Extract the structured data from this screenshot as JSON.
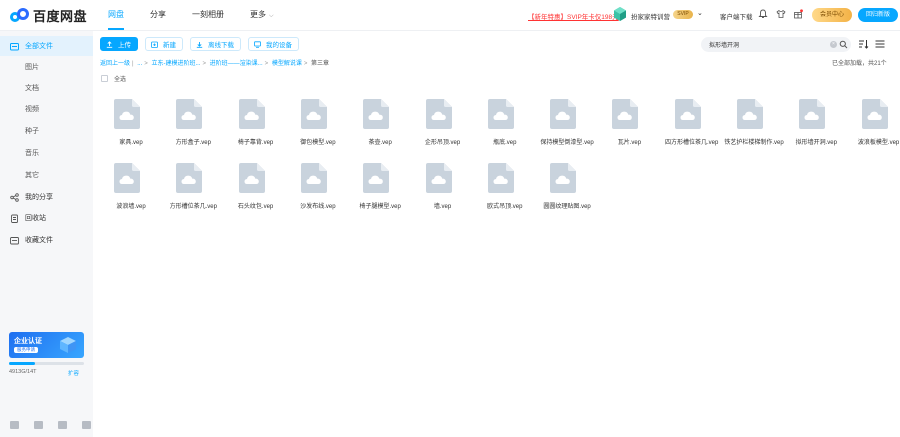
{
  "header": {
    "logo_text": "百度网盘",
    "nav": [
      {
        "label": "网盘",
        "active": true
      },
      {
        "label": "分享",
        "active": false
      },
      {
        "label": "一刻相册",
        "active": false
      },
      {
        "label": "更多",
        "active": false
      }
    ],
    "promo": "【新年特惠】SVIP年卡仅198元",
    "username": "扮家家特训营",
    "svip_badge": "SVIP",
    "client_download": "客户端下载",
    "member_center": "会员中心",
    "new_version": "回归新版",
    "accent": "#06a7ff"
  },
  "sidebar": {
    "items": [
      {
        "label": "全部文件",
        "icon": "folder-icon",
        "active": true
      },
      {
        "label": "图片",
        "sub": true
      },
      {
        "label": "文档",
        "sub": true
      },
      {
        "label": "视频",
        "sub": true
      },
      {
        "label": "种子",
        "sub": true
      },
      {
        "label": "音乐",
        "sub": true
      },
      {
        "label": "其它",
        "sub": true
      },
      {
        "label": "我的分享",
        "icon": "share-icon"
      },
      {
        "label": "回收站",
        "icon": "trash-icon"
      },
      {
        "label": "收藏文件",
        "icon": "star-icon"
      }
    ],
    "enterprise": {
      "title": "企业认证",
      "tag": "服务申请"
    },
    "quota": {
      "text": "4913G/14T",
      "used_fraction": 0.35
    },
    "expand": "扩容"
  },
  "toolbar": {
    "upload": "上传",
    "new": "新建",
    "offline": "离线下载",
    "device": "我的设备"
  },
  "search": {
    "value": "拟形墙开洞"
  },
  "breadcrumb": {
    "items": [
      "返回上一级",
      "...",
      "立东-建模进阶班...",
      "进阶班——渲染课...",
      "模型解说课"
    ],
    "current": "第三章"
  },
  "loaded_info": "已全部加载，共21个",
  "select_all": "全选",
  "files": [
    "家具.vep",
    "方形盒子.vep",
    "椅子靠背.vep",
    "御包模型.vep",
    "茶壶.vep",
    "企形吊顶.vep",
    "瓶底.vep",
    "保持模型倒漆型.vep",
    "瓦片.vep",
    "四方形槽位茶几.vep",
    "铁艺护栏楼梯制作.vep",
    "拟形墙开洞.vep",
    "波浪板模型.vep",
    "波浪墙.vep",
    "方形槽位茶几.vep",
    "石头纹包.vep",
    "沙发布线.vep",
    "椅子腿模型.vep",
    "墙.vep",
    "欧式吊顶.vep",
    "圆圆纹理贴图.vep"
  ]
}
